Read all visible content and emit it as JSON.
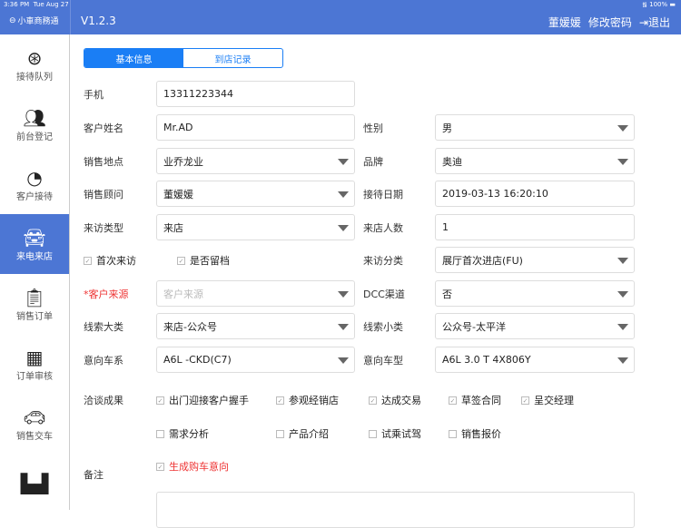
{
  "status_bar": {
    "time": "3:36 PM",
    "date": "Tue Aug 27",
    "battery": "100%"
  },
  "header": {
    "app_name": "小車商務通",
    "version": "V1.2.3",
    "user": "董媛媛",
    "change_password": "修改密码",
    "logout": "退出"
  },
  "sidebar": {
    "items": [
      {
        "label": "接待队列",
        "icon": "steering-wheel-icon"
      },
      {
        "label": "前台登记",
        "icon": "users-icon"
      },
      {
        "label": "客户接待",
        "icon": "pie-chart-icon"
      },
      {
        "label": "来电来店",
        "icon": "car-icon"
      },
      {
        "label": "销售订单",
        "icon": "clipboard-icon"
      },
      {
        "label": "订单审核",
        "icon": "calculator-icon"
      },
      {
        "label": "销售交车",
        "icon": "car-delivery-icon"
      },
      {
        "label": "",
        "icon": "more-icon"
      }
    ],
    "active": 3
  },
  "tabs": [
    {
      "label": "基本信息"
    },
    {
      "label": "到店记录"
    }
  ],
  "form": {
    "phone": {
      "label": "手机",
      "value": "13311223344"
    },
    "name": {
      "label": "客户姓名",
      "value": "Mr.AD"
    },
    "gender": {
      "label": "性别",
      "value": "男"
    },
    "location": {
      "label": "销售地点",
      "value": "业乔龙业"
    },
    "brand": {
      "label": "品牌",
      "value": "奥迪"
    },
    "consultant": {
      "label": "销售顾问",
      "value": "董媛媛"
    },
    "date": {
      "label": "接待日期",
      "value": "2019-03-13 16:20:10"
    },
    "visit_type": {
      "label": "来访类型",
      "value": "来店"
    },
    "visitors": {
      "label": "来店人数",
      "value": "1"
    },
    "first_visit": {
      "label": "首次来访",
      "checked": true
    },
    "keep_record": {
      "label": "是否留档",
      "checked": true
    },
    "visit_category": {
      "label": "来访分类",
      "value": "展厅首次进店(FU)"
    },
    "source": {
      "label": "*客户来源",
      "placeholder": "客户来源"
    },
    "dcc": {
      "label": "DCC渠道",
      "value": "否"
    },
    "lead_major": {
      "label": "线索大类",
      "value": "来店-公众号"
    },
    "lead_minor": {
      "label": "线索小类",
      "value": "公众号-太平洋"
    },
    "series": {
      "label": "意向车系",
      "value": "A6L -CKD(C7)"
    },
    "model": {
      "label": "意向车型",
      "value": "A6L 3.0 T 4X806Y"
    },
    "results_label": "洽谈成果",
    "results": [
      {
        "label": "出门迎接客户握手",
        "checked": true
      },
      {
        "label": "参观经销店",
        "checked": true
      },
      {
        "label": "达成交易",
        "checked": true
      },
      {
        "label": "草签合同",
        "checked": true
      },
      {
        "label": "呈交经理",
        "checked": true
      },
      {
        "label": "需求分析",
        "checked": false
      },
      {
        "label": "产品介绍",
        "checked": false
      },
      {
        "label": "试乘试驾",
        "checked": false
      },
      {
        "label": "销售报价",
        "checked": false
      }
    ],
    "intent": {
      "label": "生成购车意向",
      "checked": true
    },
    "remark_label": "备注"
  }
}
